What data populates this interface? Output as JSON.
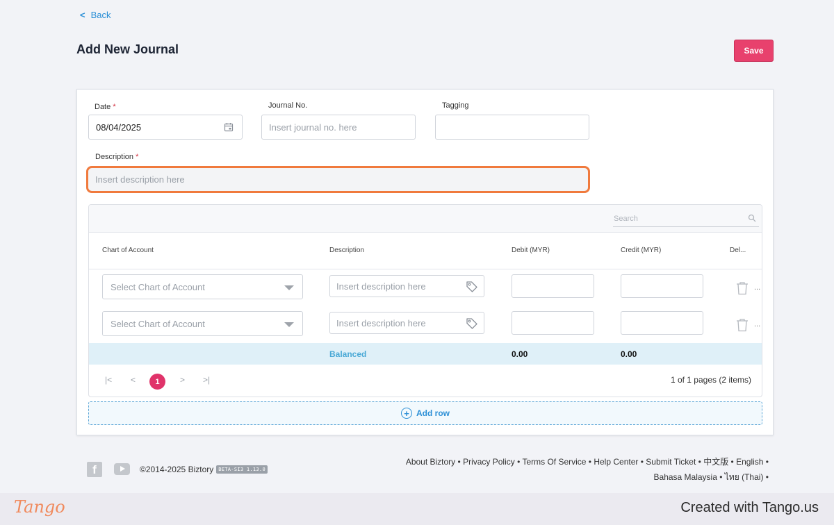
{
  "nav": {
    "back_label": "Back"
  },
  "page": {
    "title": "Add New Journal",
    "save_label": "Save"
  },
  "form": {
    "date_label": "Date",
    "required_mark": "*",
    "date_value": "08/04/2025",
    "journal_no_label": "Journal No.",
    "journal_no_placeholder": "Insert journal no. here",
    "tagging_label": "Tagging",
    "description_label": "Description",
    "description_placeholder": "Insert description here"
  },
  "grid": {
    "search_placeholder": "Search",
    "columns": [
      "Chart of Account",
      "Description",
      "Debit (MYR)",
      "Credit (MYR)",
      "Del..."
    ],
    "rows": [
      {
        "account_placeholder": "Select Chart of Account",
        "description_placeholder": "Insert description here",
        "more": "..."
      },
      {
        "account_placeholder": "Select Chart of Account",
        "description_placeholder": "Insert description here",
        "more": "..."
      }
    ],
    "totals": {
      "status": "Balanced",
      "debit": "0.00",
      "credit": "0.00"
    },
    "pager": {
      "first": "|<",
      "prev": "<",
      "current": "1",
      "next": ">",
      "last": ">|",
      "info": "1 of 1 pages (2 items)"
    },
    "add_row_label": "Add row"
  },
  "footer": {
    "copyright": "©2014-2025 Biztory",
    "version_badge": "BETA-SI3 1.13.0",
    "links": [
      "About Biztory",
      "Privacy Policy",
      "Terms Of Service",
      "Help Center",
      "Submit Ticket",
      "中文版",
      "English",
      "Bahasa Malaysia",
      "ไทย (Thai)"
    ],
    "separator": "•",
    "facebook_glyph": "f"
  },
  "tango": {
    "logo": "Tango",
    "credit": "Created with Tango.us"
  },
  "colors": {
    "accent": "#e8416d",
    "link": "#2b8fd6",
    "highlight": "#f07a3d",
    "balanced": "#4aa9d6"
  },
  "icons": [
    "chevron-left-icon",
    "calendar-icon",
    "search-icon",
    "tag-icon",
    "trash-icon",
    "plus-circle-icon",
    "facebook-icon",
    "youtube-icon"
  ]
}
